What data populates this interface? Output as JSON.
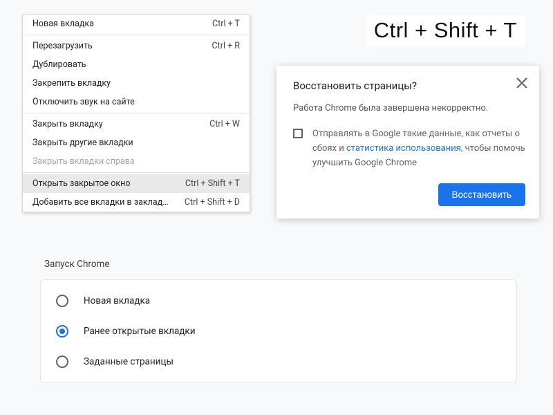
{
  "ctx_menu": {
    "items": [
      {
        "label": "Новая вкладка",
        "shortcut": "Ctrl + T"
      },
      {
        "label": "Перезагрузить",
        "shortcut": "Ctrl + R"
      },
      {
        "label": "Дублировать",
        "shortcut": ""
      },
      {
        "label": "Закрепить вкладку",
        "shortcut": ""
      },
      {
        "label": "Отключить звук на сайте",
        "shortcut": ""
      },
      {
        "label": "Закрыть вкладку",
        "shortcut": "Ctrl + W"
      },
      {
        "label": "Закрыть другие вкладки",
        "shortcut": ""
      },
      {
        "label": "Закрыть вкладки справа",
        "shortcut": ""
      },
      {
        "label": "Открыть закрытое окно",
        "shortcut": "Ctrl + Shift + T"
      },
      {
        "label": "Добавить все вкладки в закладки...",
        "shortcut": "Ctrl + Shift + D"
      }
    ]
  },
  "big_shortcut": "Ctrl + Shift + T",
  "dialog": {
    "title": "Восстановить страницы?",
    "subtitle": "Работа Chrome была завершена некорректно.",
    "checkbox_text_1": "Отправлять в Google такие данные, как отчеты о сбоях и ",
    "checkbox_link": "статистика использования",
    "checkbox_text_2": ", чтобы помочь улучшить Google Chrome",
    "button": "Восстановить"
  },
  "settings": {
    "heading": "Запуск Chrome",
    "options": [
      {
        "label": "Новая вкладка",
        "selected": false
      },
      {
        "label": "Ранее открытые вкладки",
        "selected": true
      },
      {
        "label": "Заданные страницы",
        "selected": false
      }
    ]
  }
}
